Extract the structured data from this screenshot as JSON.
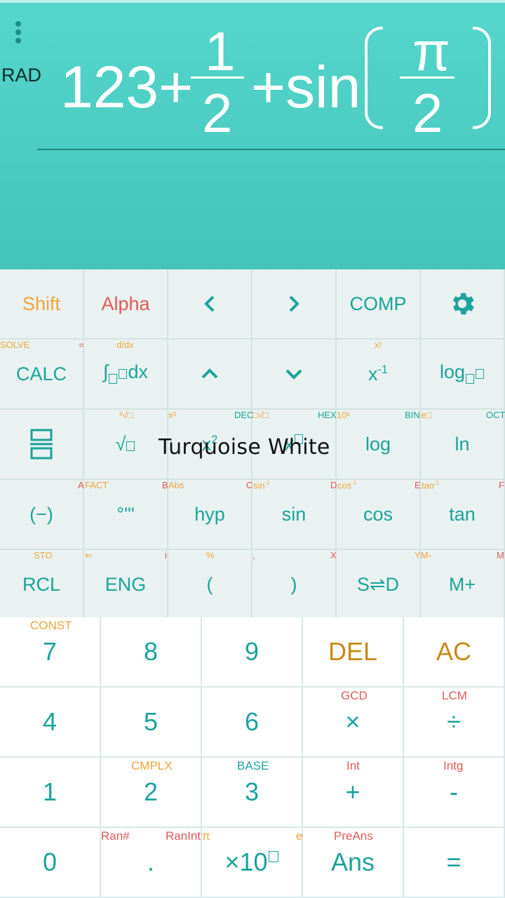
{
  "display": {
    "mode": "RAD",
    "expr": {
      "num": "123+",
      "frac1_num": "1",
      "frac1_den": "2",
      "plus_sin": "+sin",
      "frac2_num": "π",
      "frac2_den": "2"
    }
  },
  "rows": {
    "r1": [
      "Shift",
      "Alpha",
      "‹",
      "›",
      "COMP",
      "⚙"
    ],
    "r2": {
      "labels": [
        "CALC",
        "∫□□dx",
        "⌃",
        "⌄",
        "x-1",
        "log□□"
      ],
      "subs": [
        "SOLVE",
        "=",
        "d/dx",
        "x!"
      ]
    },
    "r3": {
      "labels": [
        "",
        "√□",
        "x2",
        "x□",
        "log",
        "ln"
      ],
      "subs": [
        "³√□",
        "x³",
        "DEC",
        "□√□",
        "HEX",
        "10ˣ",
        "BIN",
        "e□",
        "OCT"
      ]
    },
    "r4": {
      "labels": [
        "(−)",
        "°'\"",
        "hyp",
        "sin",
        "cos",
        "tan"
      ],
      "subs": [
        "A",
        "FACT",
        "B",
        "Abs",
        "C",
        "sin-1",
        "D",
        "cos-1",
        "E",
        "tan-1",
        "F"
      ]
    },
    "r5": {
      "labels": [
        "RCL",
        "ENG",
        "(",
        ")",
        "S⇌D",
        "M+"
      ],
      "subs": [
        "STO",
        "⇐",
        "i",
        "%",
        ",",
        "X",
        "YM-",
        "M"
      ]
    },
    "n1": [
      "7",
      "8",
      "9",
      "DEL",
      "AC"
    ],
    "n2": [
      "4",
      "5",
      "6",
      "×",
      "÷"
    ],
    "n3": [
      "1",
      "2",
      "3",
      "+",
      "-"
    ],
    "n4": [
      "0",
      ".",
      "×10□",
      "Ans",
      "="
    ],
    "nsubs": {
      "const": "CONST",
      "gcd": "GCD",
      "lcm": "LCM",
      "cmplx": "CMPLX",
      "base": "BASE",
      "int": "Int",
      "intg": "Intg",
      "ran": "Ran#",
      "ranint": "RanInt",
      "pi": "π",
      "e": "e",
      "preans": "PreAns"
    }
  },
  "toast": "Turquoise White"
}
